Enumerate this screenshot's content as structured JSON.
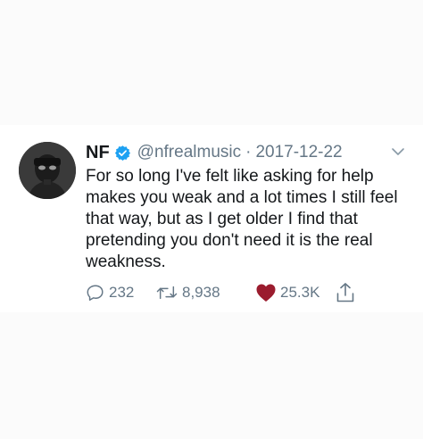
{
  "tweet": {
    "name": "NF",
    "handle": "@nfrealmusic",
    "separator": "·",
    "date": "2017-12-22",
    "text_lines": [
      "For so long I've felt like asking for help",
      "makes you weak and a lot times I still feel",
      "that way, but as I get older I find that",
      "pretending you don't need it is the real",
      "weakness."
    ],
    "replies": "232",
    "retweets": "8,938",
    "likes": "25.3K",
    "like_color": "#9b1c2e",
    "verified_color": "#1da1f2",
    "icons": {
      "avatar": "avatar",
      "verified": "verified-badge-icon",
      "caret": "chevron-down-icon",
      "reply": "reply-icon",
      "retweet": "retweet-icon",
      "like": "heart-icon",
      "share": "share-icon"
    }
  }
}
